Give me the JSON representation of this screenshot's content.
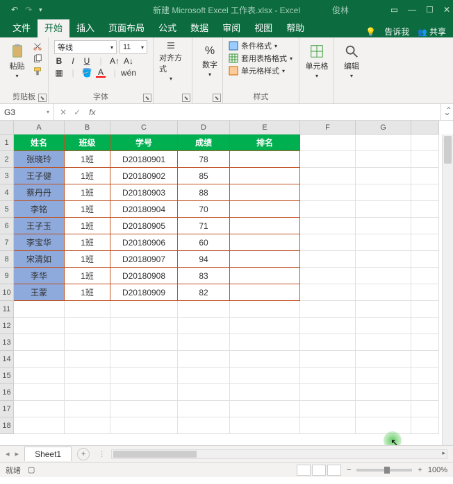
{
  "titlebar": {
    "filename": "新建 Microsoft Excel 工作表.xlsx - Excel",
    "user": "俊林"
  },
  "tabs": {
    "file": "文件",
    "home": "开始",
    "insert": "插入",
    "layout": "页面布局",
    "formulas": "公式",
    "data": "数据",
    "review": "审阅",
    "view": "视图",
    "help": "帮助",
    "tellme": "告诉我",
    "share": "共享"
  },
  "ribbon": {
    "clipboard": {
      "paste": "粘贴",
      "label": "剪贴板"
    },
    "font": {
      "name": "等线",
      "size": "11",
      "label": "字体"
    },
    "align": {
      "label": "对齐方式"
    },
    "number": {
      "btn": "数字",
      "label": "数字"
    },
    "styles": {
      "cond": "条件格式",
      "table": "套用表格格式",
      "cell": "单元格样式",
      "label": "样式"
    },
    "cells": {
      "btn": "单元格",
      "label": ""
    },
    "editing": {
      "btn": "编辑",
      "label": ""
    }
  },
  "namebox": "G3",
  "columns": [
    "A",
    "B",
    "C",
    "D",
    "E",
    "F",
    "G"
  ],
  "header_row": [
    "姓名",
    "班级",
    "学号",
    "成绩",
    "排名"
  ],
  "rows": [
    {
      "n": "张晓玲",
      "c": "1班",
      "id": "D20180901",
      "s": "78"
    },
    {
      "n": "王子健",
      "c": "1班",
      "id": "D20180902",
      "s": "85"
    },
    {
      "n": "蔡丹丹",
      "c": "1班",
      "id": "D20180903",
      "s": "88"
    },
    {
      "n": "李铭",
      "c": "1班",
      "id": "D20180904",
      "s": "70"
    },
    {
      "n": "王子玉",
      "c": "1班",
      "id": "D20180905",
      "s": "71"
    },
    {
      "n": "李宝华",
      "c": "1班",
      "id": "D20180906",
      "s": "60"
    },
    {
      "n": "宋清如",
      "c": "1班",
      "id": "D20180907",
      "s": "94"
    },
    {
      "n": "李华",
      "c": "1班",
      "id": "D20180908",
      "s": "83"
    },
    {
      "n": "王蒙",
      "c": "1班",
      "id": "D20180909",
      "s": "82"
    }
  ],
  "sheet": {
    "name": "Sheet1"
  },
  "status": {
    "ready": "就绪",
    "zoom": "100%"
  }
}
